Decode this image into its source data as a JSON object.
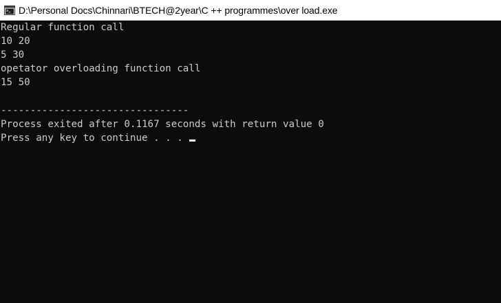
{
  "window": {
    "title": "D:\\Personal Docs\\Chinnari\\BTECH@2year\\C ++ programmes\\over load.exe",
    "icon": "console-app-icon"
  },
  "console": {
    "lines": [
      "Regular function call",
      "10 20",
      "5 30",
      "opetator overloading function call",
      "15 50",
      "",
      "--------------------------------",
      "Process exited after 0.1167 seconds with return value 0"
    ],
    "prompt": "Press any key to continue . . . "
  },
  "colors": {
    "background": "#0c0c0c",
    "text": "#cccccc",
    "cursor": "#ffffff"
  }
}
